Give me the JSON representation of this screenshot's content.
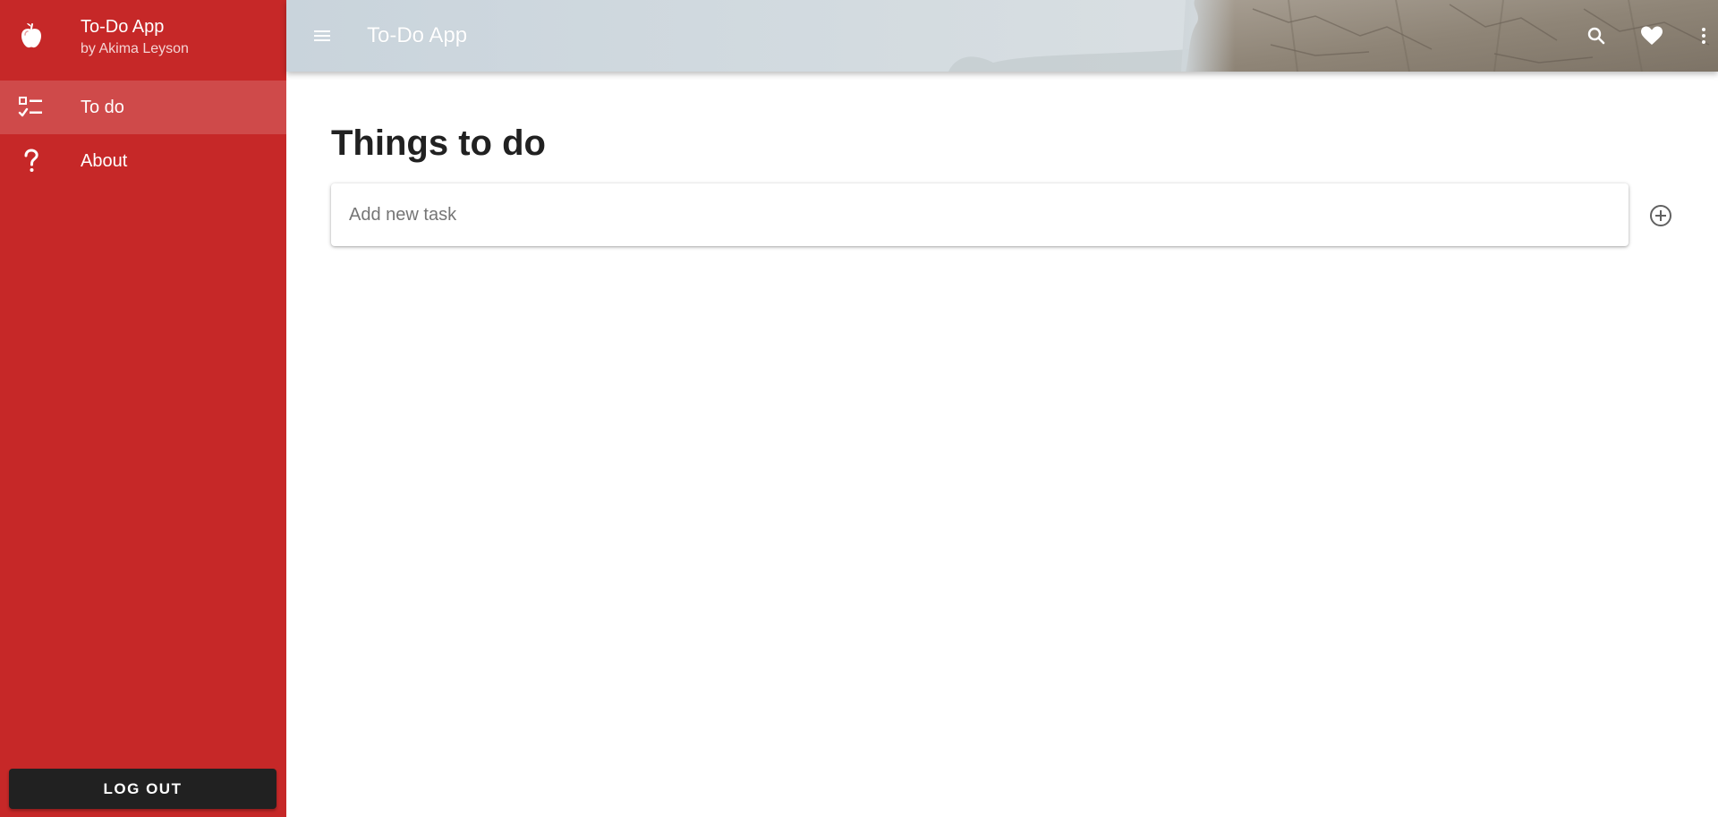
{
  "sidebar": {
    "app_name": "To-Do App",
    "app_author": "by Akima Leyson",
    "logo_icon": "apple-icon",
    "items": [
      {
        "label": "To do",
        "icon": "checklist-icon",
        "active": true
      },
      {
        "label": "About",
        "icon": "question-mark-icon",
        "active": false
      }
    ],
    "logout_label": "LOG OUT"
  },
  "header": {
    "title": "To-Do App",
    "menu_icon": "menu-icon",
    "actions": [
      "search-icon",
      "heart-icon",
      "more-vert-icon"
    ]
  },
  "main": {
    "title": "Things to do",
    "task_input": {
      "placeholder": "Add new task",
      "value": ""
    },
    "add_button_icon": "add-circle-icon"
  },
  "colors": {
    "sidebar_background": "#c62828",
    "logout_button_background": "#212121",
    "title_text": "#212121"
  }
}
